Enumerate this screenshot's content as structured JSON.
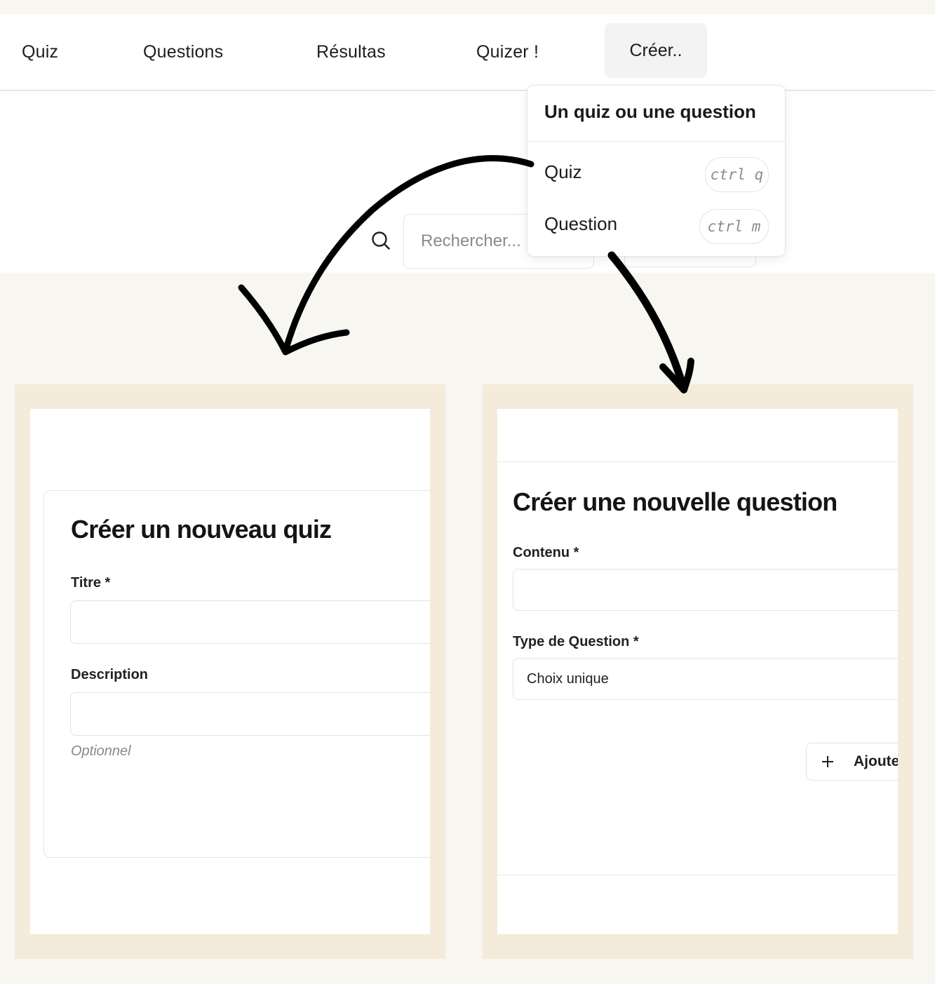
{
  "nav": {
    "items": [
      {
        "label": "Quiz"
      },
      {
        "label": "Questions"
      },
      {
        "label": "Résultas"
      },
      {
        "label": "Quizer !"
      }
    ],
    "create_label": "Créer.."
  },
  "search": {
    "placeholder": "Rechercher...",
    "icon": "search-icon"
  },
  "dropdown": {
    "header": "Un quiz ou une question",
    "items": [
      {
        "label": "Quiz",
        "shortcut": "ctrl q"
      },
      {
        "label": "Question",
        "shortcut": "ctrl m"
      }
    ]
  },
  "quiz_form": {
    "title": "Créer un nouveau quiz",
    "title_label": "Titre *",
    "description_label": "Description",
    "description_hint": "Optionnel"
  },
  "question_form": {
    "title": "Créer une nouvelle question",
    "content_label": "Contenu *",
    "type_label": "Type de Question *",
    "type_value": "Choix unique",
    "add_label": "Ajoute",
    "add_icon": "plus-icon"
  },
  "colors": {
    "page_bg": "#f8f6f1",
    "panel_frame": "#f4ebdb",
    "nav_bg": "#ffffff",
    "arrow": "#000000"
  }
}
